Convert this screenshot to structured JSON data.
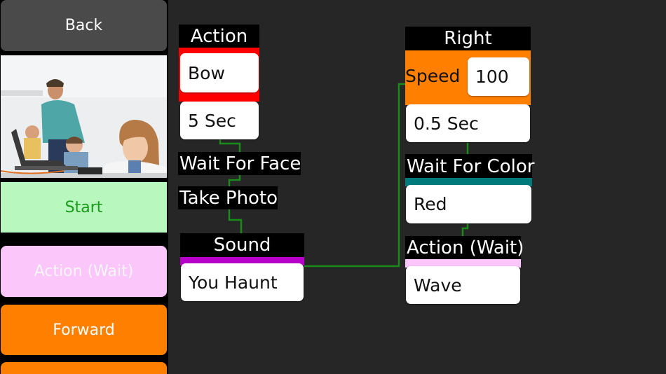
{
  "sidebar": {
    "back_label": "Back",
    "start_label": "Start",
    "action_wait_label": "Action (Wait)",
    "forward_label": "Forward"
  },
  "colors": {
    "canvas": "#262626",
    "start": "#b8f7bd",
    "action_wait": "#fbc6fa",
    "forward": "#ff8000",
    "action_strip": "#ff0000",
    "sound_strip": "#b700c9",
    "color_strip": "#007a7a",
    "wire": "#1a8a1a"
  },
  "nodes": {
    "action": {
      "title": "Action",
      "value": "Bow",
      "duration": "5 Sec"
    },
    "wait_face": {
      "title": "Wait For Face"
    },
    "take_photo": {
      "title": "Take Photo"
    },
    "sound": {
      "title": "Sound",
      "value": "You Haunt"
    },
    "right": {
      "title": "Right",
      "speed_label": "Speed",
      "speed_value": "100",
      "duration": "0.5 Sec"
    },
    "wait_color": {
      "title": "Wait For Color",
      "value": "Red"
    },
    "action_wait": {
      "title": "Action (Wait)",
      "value": "Wave"
    }
  }
}
